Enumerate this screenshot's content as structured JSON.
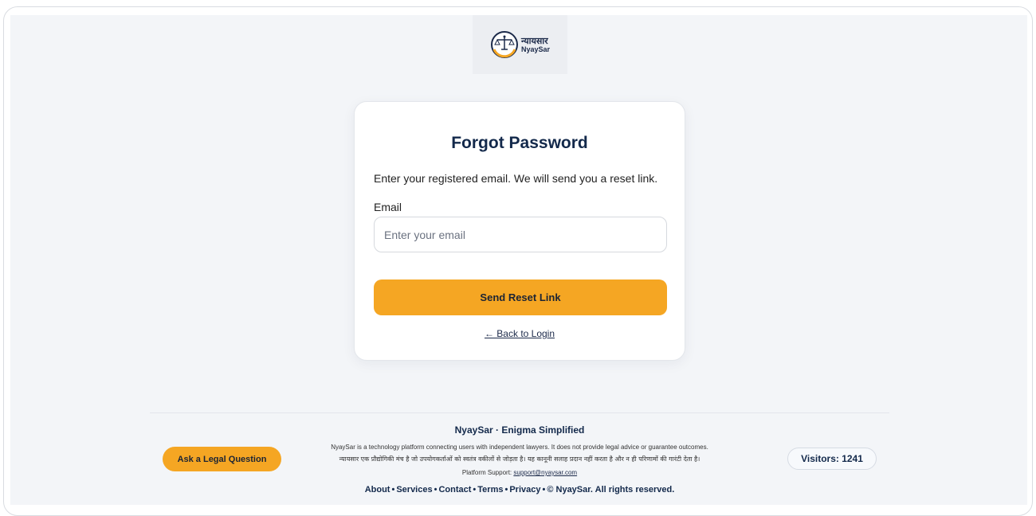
{
  "logo": {
    "name_hi": "न्यायसार",
    "name_en": "NyaySar",
    "tagline": "Enigma Simplified"
  },
  "form": {
    "title": "Forgot Password",
    "description": "Enter your registered email. We will send you a reset link.",
    "email_label": "Email",
    "email_placeholder": "Enter your email",
    "email_value": "",
    "submit_label": "Send Reset Link",
    "back_link": "← Back to Login"
  },
  "footer": {
    "title": "NyaySar · Enigma Simplified",
    "disclaimer_en": "NyaySar is a technology platform connecting users with independent lawyers. It does not provide legal advice or guarantee outcomes.",
    "disclaimer_hi": "न्यायसार एक प्रौद्योगिकी मंच है जो उपयोगकर्ताओं को स्वतंत्र वकीलों से जोड़ता है। यह कानूनी सलाह प्रदान नहीं करता है और न ही परिणामों की गारंटी देता है।",
    "support_label": "Platform Support:",
    "support_email": "support@nyaysar.com",
    "links": [
      "About",
      "Services",
      "Contact",
      "Terms",
      "Privacy"
    ],
    "copyright": "© NyaySar. All rights reserved.",
    "ask_button": "Ask a Legal Question",
    "visitors": "Visitors: 1241"
  },
  "colors": {
    "accent": "#f5a623",
    "navy": "#13294b",
    "background": "#f3f5f8"
  }
}
